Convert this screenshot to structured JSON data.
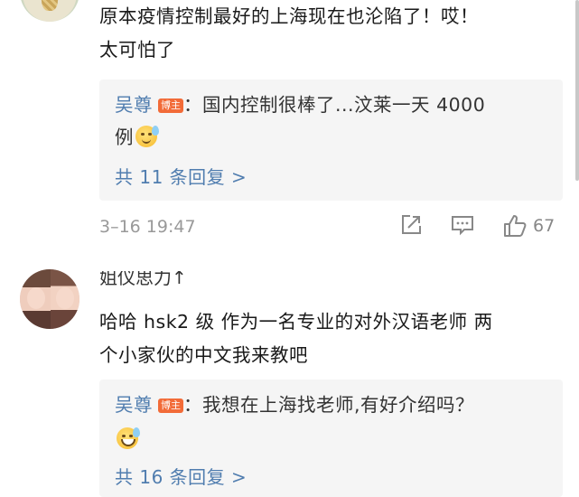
{
  "comments": [
    {
      "text_line1": "原本疫情控制最好的上海现在也沦陷了！哎！",
      "text_line2": "太可怕了",
      "reply": {
        "author": "吴尊",
        "badge": "博主",
        "text_line1": "：国内控制很棒了...汶莱一天 4000",
        "text_line2": "例",
        "emoji": "sweat-emoji",
        "more_label": "共 11 条回复 >"
      },
      "time": "3–16 19:47",
      "likes": "67"
    },
    {
      "author_clipped": "姐仪思力↑",
      "text_line1": "哈哈 hsk2 级  作为一名专业的对外汉语老师  两",
      "text_line2": "个小家伙的中文我来教吧",
      "reply": {
        "author": "吴尊",
        "badge": "博主",
        "text_line1": "：我想在上海找老师,有好介绍吗？",
        "emoji": "grin-sweat-emoji",
        "more_label": "共 16 条回复 >"
      }
    }
  ],
  "colors": {
    "link": "#507daf",
    "badge": "#f26b38",
    "meta": "#999999"
  }
}
